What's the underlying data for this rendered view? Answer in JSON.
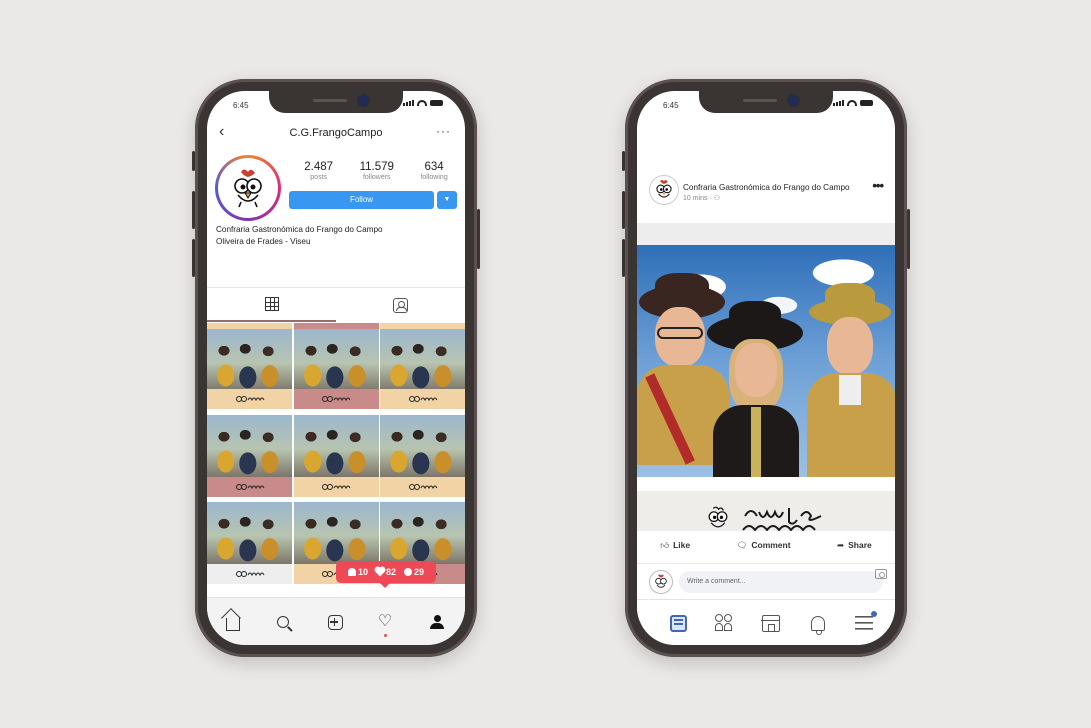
{
  "instagram": {
    "status_time": "6:45",
    "username": "C.G.FrangoCampo",
    "stats": [
      {
        "value": "2.487",
        "label": "posts"
      },
      {
        "value": "11.579",
        "label": "followers"
      },
      {
        "value": "634",
        "label": "following"
      }
    ],
    "follow_label": "Follow",
    "bio_line1": "Confraria Gastronómica do Frango do Campo",
    "bio_line2": "Oliveira de Frades - Viseu",
    "notifications": {
      "follows": "10",
      "likes": "82",
      "comments": "29"
    },
    "strip_colors": [
      "#f1d3a5",
      "#c98a8a",
      "#f1d3a5",
      "#c98a8a",
      "#f1d3a5",
      "#f1d3a5",
      "#eee",
      "#f1d3a5",
      "#c98a8a"
    ]
  },
  "facebook": {
    "status_time": "6:45",
    "page_name": "Confraria Gastronómica do Frango do Campo",
    "post_time": "10 mins",
    "like_label": "Like",
    "comment_label": "Comment",
    "share_label": "Share",
    "comment_placeholder": "Write a comment..."
  }
}
